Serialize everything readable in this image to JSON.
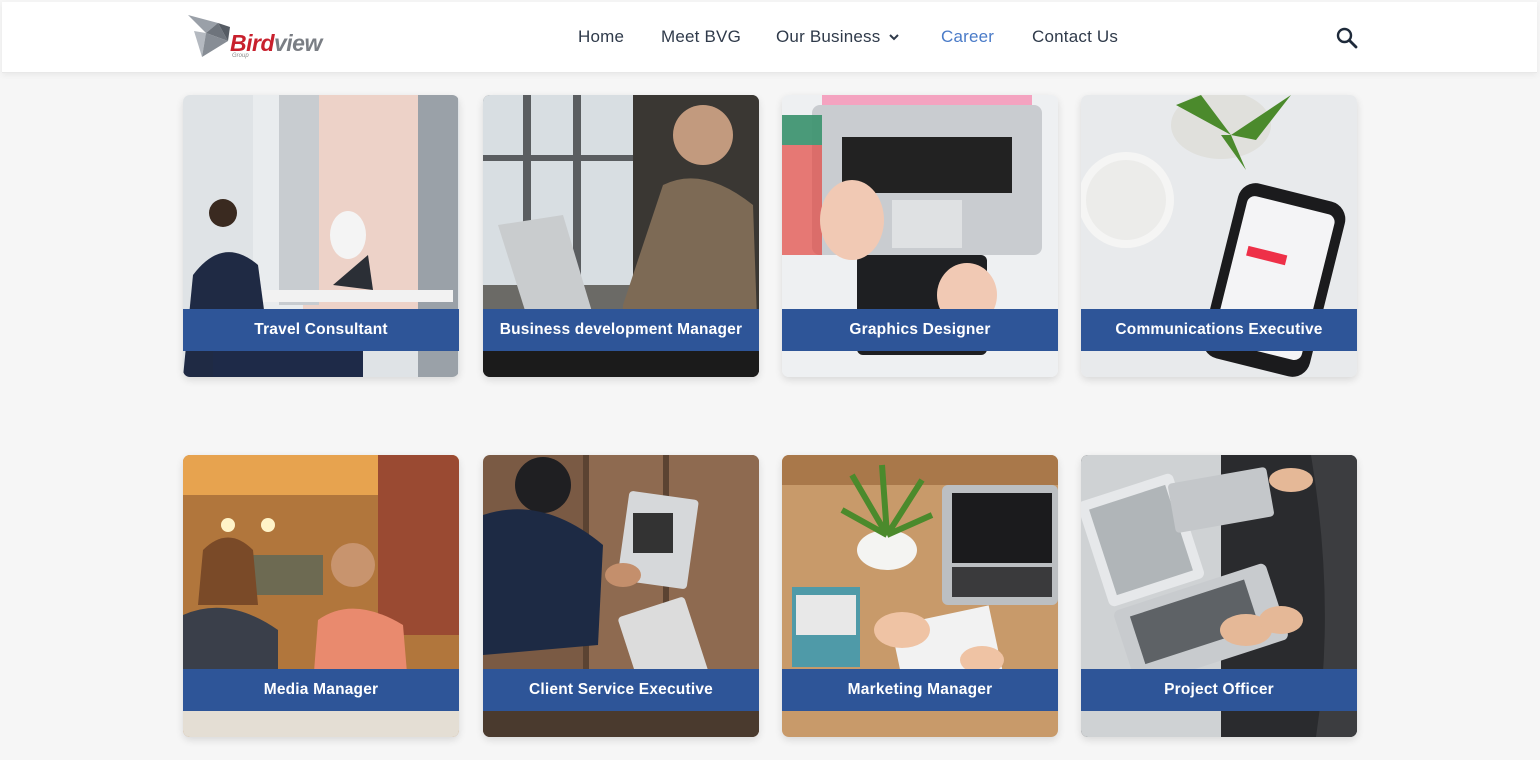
{
  "header": {
    "logo": {
      "brand_part1": "Bird",
      "brand_part2": "view",
      "brand_sub": "Group"
    },
    "nav": [
      {
        "label": "Home",
        "active": false
      },
      {
        "label": "Meet BVG",
        "active": false
      },
      {
        "label": "Our Business",
        "active": false,
        "has_dropdown": true
      },
      {
        "label": "Career",
        "active": true
      },
      {
        "label": "Contact Us",
        "active": false
      }
    ],
    "search_icon": "search-icon"
  },
  "colors": {
    "band": "#2e5598",
    "nav_active": "#4a7bc8",
    "nav_text": "#2f3a4a",
    "logo_red": "#c8202d",
    "page_bg": "#f6f6f6"
  },
  "careers": [
    {
      "title": "Travel Consultant"
    },
    {
      "title": "Business development Manager"
    },
    {
      "title": "Graphics Designer"
    },
    {
      "title": "Communications Executive"
    },
    {
      "title": "Media Manager"
    },
    {
      "title": "Client Service Executive"
    },
    {
      "title": "Marketing Manager"
    },
    {
      "title": "Project Officer"
    }
  ]
}
